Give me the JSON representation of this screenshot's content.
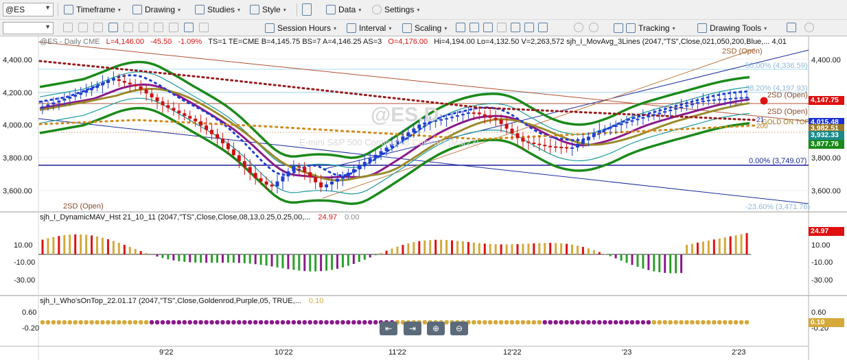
{
  "toolbar1": {
    "symbol": "@ES",
    "timeframe": "Timeframe",
    "drawing": "Drawing",
    "studies": "Studies",
    "style": "Style",
    "data": "Data",
    "settings": "Settings"
  },
  "toolbar2": {
    "session_hours": "Session Hours",
    "interval": "Interval",
    "scaling": "Scaling",
    "tracking": "Tracking",
    "drawing_tools": "Drawing Tools"
  },
  "header": {
    "symbol_info": "@ES - Daily  CME",
    "l": "L=4,146.00",
    "chg": "-45.50",
    "pct": "-1.09%",
    "rest": "TS=1  TE=CME  B=4,145.75  BS=7  A=4,146.25  AS=3",
    "open": "O=4,176.00",
    "hilo": "Hi=4,194.00  Lo=4,132.50  V=2,263,572  sjh_I_MovAvg_3Lines (2047,\"TS\",Close,021,050,200,Blue,... 4,01"
  },
  "watermark": {
    "symbol": "@ES.D",
    "desc": "E-mini S&P 500 Continuous Contract [Mar23]"
  },
  "price_axis": [
    "4,400.00",
    "4,200.00",
    "4,000.00",
    "3,800.00",
    "3,600.00"
  ],
  "fib": {
    "f50": "50.00% (4,336.59)",
    "f38": "38.20% (4,197.93)",
    "f0": "0.00% (3,749.07)",
    "fm23": "-23.60% (3,471.76)"
  },
  "annotations": {
    "sd_top": "2SD (Open)",
    "sd_right1": "2SD (Open)",
    "sd_right2": "2SD (Open)",
    "sd_bottom": "2SD (Open)",
    "ma21": "21",
    "ma200": "200",
    "gold_on_top": "GOLD ON TOP"
  },
  "price_tags": [
    {
      "text": "4,147.75",
      "color": "#e01010"
    },
    {
      "text": "4,015.48",
      "color": "#1a2fd6"
    },
    {
      "text": "3,982.51",
      "color": "#9a7a2a"
    },
    {
      "text": "3,932.33",
      "color": "#1a8a8a"
    },
    {
      "text": "3,877.76",
      "color": "#1a8a1a"
    }
  ],
  "ind1": {
    "title": "sjh_I_DynamicMAV_Hst 21_10_11 (2047,\"TS\",Close,Close,08,13,0.25,0.25,00,...",
    "v1": "24.97",
    "v2": "0.00",
    "axis": [
      "10.00",
      "-10.00",
      "-30.00"
    ],
    "tag": "24.97"
  },
  "ind2": {
    "title": "sjh_I_Who'sOnTop_22.01.17 (2047,\"TS\",Close,Goldenrod,Purple,05, TRUE,...",
    "v1": "0.10",
    "axis": [
      "0.60",
      "-0.20"
    ],
    "tag": "0.10"
  },
  "time_axis": [
    "9'22",
    "10'22",
    "11'22",
    "12'22",
    "'23",
    "2'23"
  ],
  "colors": {
    "up": "#1f3fd1",
    "down": "#d01010",
    "gold": "#d4a93a",
    "purple": "#8a1a8a",
    "green": "#2aa02a",
    "red": "#e01010"
  }
}
